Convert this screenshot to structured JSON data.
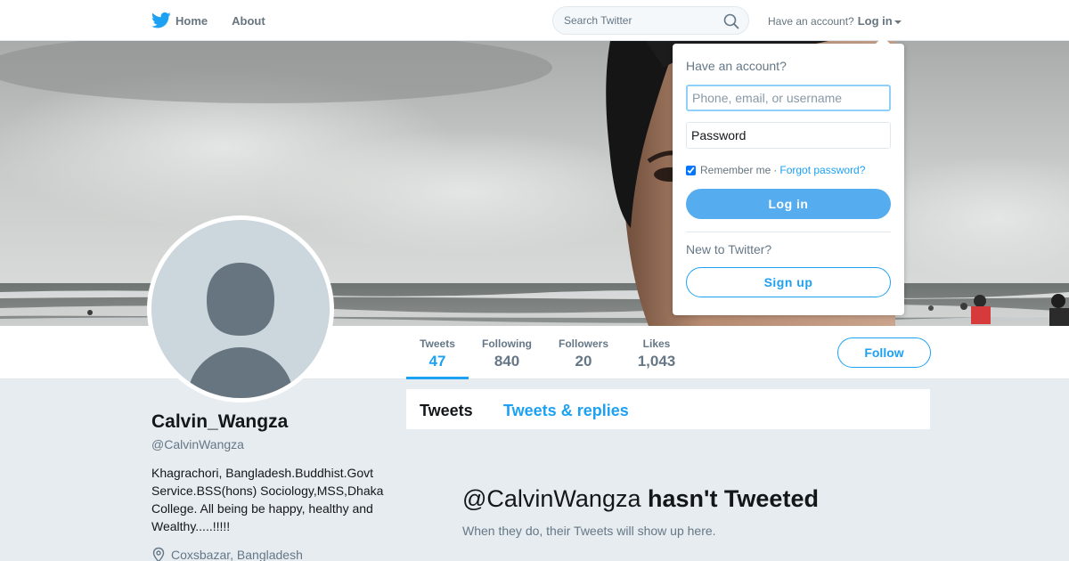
{
  "nav": {
    "home_label": "Home",
    "about_label": "About",
    "search_placeholder": "Search Twitter",
    "have_account": "Have an account?",
    "login_label": "Log in"
  },
  "profile": {
    "name": "Calvin_Wangza",
    "handle": "@CalvinWangza",
    "bio": "Khagrachori, Bangladesh.Buddhist.Govt Service.BSS(hons) Sociology,MSS,Dhaka College. All being be happy, healthy and Wealthy.....!!!!!",
    "location": "Coxsbazar, Bangladesh"
  },
  "stats": [
    {
      "label": "Tweets",
      "value": "47",
      "active": true
    },
    {
      "label": "Following",
      "value": "840",
      "active": false
    },
    {
      "label": "Followers",
      "value": "20",
      "active": false
    },
    {
      "label": "Likes",
      "value": "1,043",
      "active": false
    }
  ],
  "follow_label": "Follow",
  "timeline": {
    "tabs": [
      {
        "label": "Tweets",
        "active": true
      },
      {
        "label": "Tweets & replies",
        "active": false
      }
    ],
    "empty_handle": "@CalvinWangza",
    "empty_suffix": "hasn't Tweeted",
    "empty_sub": "When they do, their Tweets will show up here."
  },
  "login_dropdown": {
    "question": "Have an account?",
    "username_placeholder": "Phone, email, or username",
    "password_placeholder": "Password",
    "remember_label": "Remember me",
    "separator": "·",
    "forgot_label": "Forgot password?",
    "remember_checked": true,
    "login_button": "Log in",
    "new_question": "New to Twitter?",
    "signup_button": "Sign up"
  },
  "colors": {
    "accent": "#1da1f2",
    "login_button": "#55acee",
    "background": "#e6ecf0",
    "avatar_bg": "#ccd6dd",
    "avatar_silhouette": "#66757f"
  },
  "icons": [
    "twitter-bird-icon",
    "search-icon",
    "caret-down-icon",
    "location-pin-icon",
    "checkbox-icon"
  ]
}
